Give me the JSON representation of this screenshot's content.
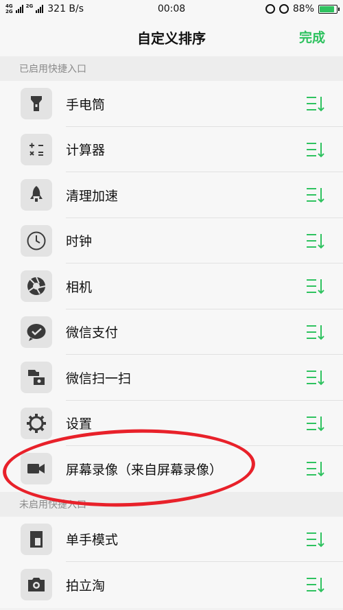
{
  "status_bar": {
    "net_top": "4G",
    "net_bottom": "2G",
    "net2_top": "2G",
    "speed": "321 B/s",
    "time": "00:08",
    "battery": "88%",
    "battery_level": 0.88
  },
  "header": {
    "title": "自定义排序",
    "done_label": "完成"
  },
  "enabled_section": {
    "label": "已启用快捷入口",
    "items": [
      {
        "label": "手电筒",
        "icon": "flashlight-icon"
      },
      {
        "label": "计算器",
        "icon": "calculator-icon"
      },
      {
        "label": "清理加速",
        "icon": "rocket-icon"
      },
      {
        "label": "时钟",
        "icon": "clock-icon"
      },
      {
        "label": "相机",
        "icon": "camera-aperture-icon"
      },
      {
        "label": "微信支付",
        "icon": "wechat-pay-icon"
      },
      {
        "label": "微信扫一扫",
        "icon": "wechat-scan-icon"
      },
      {
        "label": "设置",
        "icon": "gear-icon"
      },
      {
        "label": "屏幕录像（来自屏幕录像）",
        "icon": "video-camera-icon"
      }
    ]
  },
  "disabled_section": {
    "label": "未启用快捷入口",
    "items": [
      {
        "label": "单手模式",
        "icon": "one-hand-mode-icon"
      },
      {
        "label": "拍立淘",
        "icon": "camera-icon"
      }
    ]
  },
  "colors": {
    "accent": "#2ec25f",
    "annotation": "#e8212a",
    "icon": "#3a3a3a"
  }
}
